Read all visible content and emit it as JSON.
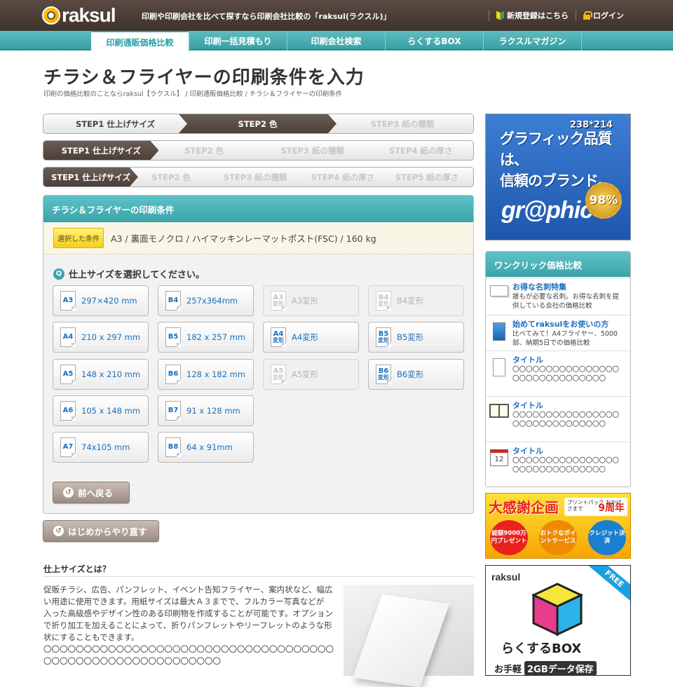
{
  "header": {
    "logo": "raksul",
    "tagline": "印刷や印刷会社を比べて探すなら印刷会社比較の「raksul(ラクスル)」",
    "register": "新規登録はこちら",
    "login": "ログイン"
  },
  "nav": [
    "印刷通販価格比較",
    "印刷一括見積もり",
    "印刷会社検索",
    "らくするBOX",
    "ラクスルマガジン"
  ],
  "page": {
    "title": "チラシ＆フライヤーの印刷条件を入力",
    "breadcrumb": "印刷の価格比較のことならraksul【ラクスル】 / 印刷通販価格比較 / チラシ＆フライヤーの印刷条件"
  },
  "steps3": [
    "STEP1 仕上げサイズ",
    "STEP2 色",
    "STEP3 紙の種類"
  ],
  "steps4": [
    "STEP1 仕上げサイズ",
    "STEP2 色",
    "STEP3 紙の種類",
    "STEP4 紙の厚さ"
  ],
  "steps5": [
    "STEP1 仕上げサイズ",
    "STEP2 色",
    "STEP3 紙の種類",
    "STEP4 紙の厚さ",
    "STEP5 紙の厚さ"
  ],
  "panel": {
    "heading": "チラシ＆フライヤーの印刷条件",
    "selected_label": "選択した条件",
    "selected_value": "A3 / 裏面モノクロ / ハイマッキンレーマットポスト(FSC) / 160 kg",
    "question": "仕上サイズを選択してください。",
    "question_icon": "Q"
  },
  "sizes": [
    {
      "code": "A3",
      "sub": "",
      "label": "297×420 mm",
      "enabled": true
    },
    {
      "code": "B4",
      "sub": "",
      "label": "257x364mm",
      "enabled": true
    },
    {
      "code": "A3",
      "sub": "変形",
      "label": "A3変形",
      "enabled": false
    },
    {
      "code": "B4",
      "sub": "変形",
      "label": "B4変形",
      "enabled": false
    },
    {
      "code": "A4",
      "sub": "",
      "label": "210 x 297 mm",
      "enabled": true
    },
    {
      "code": "B5",
      "sub": "",
      "label": "182 x 257 mm",
      "enabled": true
    },
    {
      "code": "A4",
      "sub": "変形",
      "label": "A4変形",
      "enabled": true
    },
    {
      "code": "B5",
      "sub": "変形",
      "label": "B5変形",
      "enabled": true
    },
    {
      "code": "A5",
      "sub": "",
      "label": "148 x 210 mm",
      "enabled": true
    },
    {
      "code": "B6",
      "sub": "",
      "label": "128 x 182 mm",
      "enabled": true
    },
    {
      "code": "A5",
      "sub": "変形",
      "label": "A5変形",
      "enabled": false
    },
    {
      "code": "B6",
      "sub": "変形",
      "label": "B6変形",
      "enabled": true
    },
    {
      "code": "A6",
      "sub": "",
      "label": "105 x 148 mm",
      "enabled": true
    },
    {
      "code": "B7",
      "sub": "",
      "label": "91 x 128 mm",
      "enabled": true
    },
    {
      "code": "A7",
      "sub": "",
      "label": "74x105 mm",
      "enabled": true
    },
    {
      "code": "B8",
      "sub": "",
      "label": "64 x 91mm",
      "enabled": true
    }
  ],
  "buttons": {
    "back": "前へ戻る",
    "restart": "はじめからやり直す"
  },
  "about": {
    "heading": "仕上サイズとは？",
    "text": "促販チラシ、広告、パンフレット、イベント告知フライヤー、案内状など、幅広い用途に使用できます。用紙サイズは最大Ａ３までで、フルカラー写真などが 入った高級感やデザイン性のある印刷物を作成することが可能です。オプションで折り加工を加えることによって、折りパンフレットやリーフレットのような形状にすることもできます。",
    "placeholder": "〇〇〇〇〇〇〇〇〇〇〇〇〇〇〇〇〇〇〇〇〇〇〇〇〇〇〇〇〇〇〇〇〇〇〇〇〇〇〇〇〇〇〇〇〇〇〇〇〇〇〇〇〇〇〇〇〇〇"
  },
  "sidebar": {
    "ad_graphic": {
      "dim": "238*214",
      "line1": "グラフィック品質は、",
      "line2": "信頼のブランド。",
      "brand": "gr@phic",
      "badge": "98%"
    },
    "oneclick": {
      "heading": "ワンクリック価格比較",
      "items": [
        {
          "title": "お得な名刺特集",
          "text": "誰もが必要な名刺。お得な名刺を提供している会社の価格比較",
          "icon": "business-card-icon"
        },
        {
          "title": "始めてraksulをお使いの方",
          "text": "比べてみて！A4フライヤー、5000部、納期5日での価格比較",
          "icon": "flyer-icon"
        },
        {
          "title": "タイトル",
          "text": "〇〇〇〇〇〇〇〇〇〇〇〇〇〇〇〇〇〇〇〇〇〇〇〇〇〇〇〇〇〇",
          "icon": "document-icon"
        },
        {
          "title": "タイトル",
          "text": "〇〇〇〇〇〇〇〇〇〇〇〇〇〇〇〇〇〇〇〇〇〇〇〇〇〇〇〇〇〇",
          "icon": "book-icon"
        },
        {
          "title": "タイトル",
          "text": "〇〇〇〇〇〇〇〇〇〇〇〇〇〇〇〇〇〇〇〇〇〇〇〇〇〇〇〇〇〇",
          "icon": "calendar-icon"
        }
      ]
    },
    "ad_campaign": {
      "title": "大感謝企画",
      "right": "プリントパック おかげさまで",
      "years": "9周年",
      "c1": "総額9000万円プレゼント",
      "c2": "おトクなポイントサービス",
      "c3": "クレジット決済"
    },
    "ad_box": {
      "logo": "raksul",
      "free": "FREE",
      "name": "らくするBOX",
      "sub1": "お手軽",
      "sub2": "2GBデータ保存"
    }
  }
}
